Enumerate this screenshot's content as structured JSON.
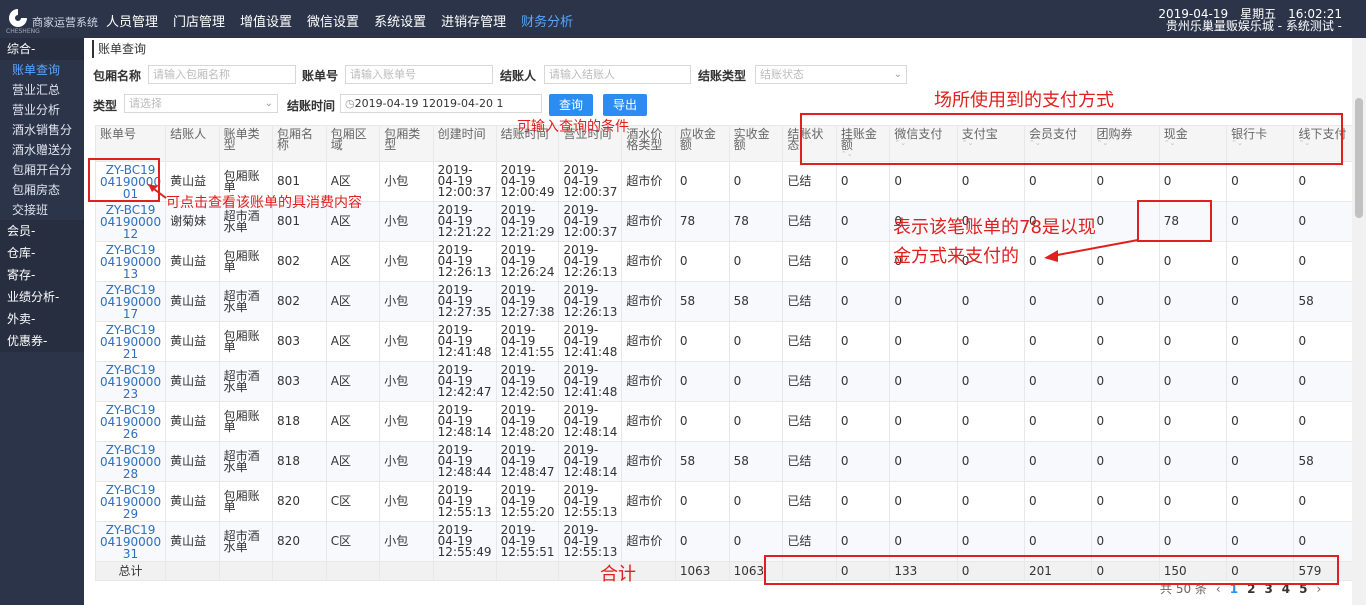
{
  "header": {
    "logo_text": "CHESHENG",
    "brand": "商家运营系统",
    "nav": [
      "人员管理",
      "门店管理",
      "增值设置",
      "微信设置",
      "系统设置",
      "进销存管理",
      "财务分析"
    ],
    "active_nav": "财务分析",
    "datetime": "2019-04-19　星期五　16:02:21",
    "store": "贵州乐巢量贩娱乐城 - 系统测试 -"
  },
  "sidebar": {
    "groups": [
      {
        "label": "综合-",
        "items": [
          "账单查询",
          "营业汇总",
          "营业分析",
          "酒水销售分",
          "酒水赠送分",
          "包厢开台分",
          "包厢房态",
          "交接班"
        ]
      },
      {
        "label": "会员-",
        "items": []
      },
      {
        "label": "仓库-",
        "items": []
      },
      {
        "label": "寄存-",
        "items": []
      },
      {
        "label": "业绩分析-",
        "items": []
      },
      {
        "label": "外卖-",
        "items": []
      },
      {
        "label": "优惠券-",
        "items": []
      }
    ],
    "active_item": "账单查询"
  },
  "breadcrumb": "账单查询",
  "filters": {
    "room_name": {
      "label": "包厢名称",
      "placeholder": "请输入包厢名称"
    },
    "bill_no": {
      "label": "账单号",
      "placeholder": "请输入账单号"
    },
    "cashier": {
      "label": "结账人",
      "placeholder": "请输入结账人"
    },
    "settle_type": {
      "label": "结账类型",
      "placeholder": "结账状态"
    },
    "type": {
      "label": "类型",
      "placeholder": "请选择"
    },
    "settle_time": {
      "label": "结账时间",
      "start": "2019-04-19 1",
      "end": "2019-04-20 1"
    },
    "query_button": "查询",
    "export_button": "导出"
  },
  "table": {
    "columns": [
      "账单号",
      "结账人",
      "账单类型",
      "包厢名称",
      "包厢区域",
      "包厢类型",
      "创建时间",
      "结账时间",
      "营业时间",
      "酒水价格类型",
      "应收金额",
      "实收金额",
      "结账状态",
      "挂账金额",
      "微信支付",
      "支付宝",
      "会员支付",
      "团购券",
      "现金",
      "银行卡",
      "线下支付"
    ],
    "rows": [
      [
        "ZY-BC19 04190000 01",
        "黄山益",
        "包厢账单",
        "801",
        "A区",
        "小包",
        "2019-04-19 12:00:37",
        "2019-04-19 12:00:49",
        "2019-04-19 12:00:37",
        "超市价",
        "0",
        "0",
        "已结",
        "0",
        "0",
        "0",
        "0",
        "0",
        "0",
        "0",
        "0"
      ],
      [
        "ZY-BC19 04190000 12",
        "谢菊妹",
        "超市酒水单",
        "801",
        "A区",
        "小包",
        "2019-04-19 12:21:22",
        "2019-04-19 12:21:29",
        "2019-04-19 12:00:37",
        "超市价",
        "78",
        "78",
        "已结",
        "0",
        "0",
        "0",
        "0",
        "0",
        "78",
        "0",
        "0"
      ],
      [
        "ZY-BC19 04190000 13",
        "黄山益",
        "包厢账单",
        "802",
        "A区",
        "小包",
        "2019-04-19 12:26:13",
        "2019-04-19 12:26:24",
        "2019-04-19 12:26:13",
        "超市价",
        "0",
        "0",
        "已结",
        "0",
        "0",
        "0",
        "0",
        "0",
        "0",
        "0",
        "0"
      ],
      [
        "ZY-BC19 04190000 17",
        "黄山益",
        "超市酒水单",
        "802",
        "A区",
        "小包",
        "2019-04-19 12:27:35",
        "2019-04-19 12:27:38",
        "2019-04-19 12:26:13",
        "超市价",
        "58",
        "58",
        "已结",
        "0",
        "0",
        "0",
        "0",
        "0",
        "0",
        "0",
        "58"
      ],
      [
        "ZY-BC19 04190000 21",
        "黄山益",
        "包厢账单",
        "803",
        "A区",
        "小包",
        "2019-04-19 12:41:48",
        "2019-04-19 12:41:55",
        "2019-04-19 12:41:48",
        "超市价",
        "0",
        "0",
        "已结",
        "0",
        "0",
        "0",
        "0",
        "0",
        "0",
        "0",
        "0"
      ],
      [
        "ZY-BC19 04190000 23",
        "黄山益",
        "超市酒水单",
        "803",
        "A区",
        "小包",
        "2019-04-19 12:42:47",
        "2019-04-19 12:42:50",
        "2019-04-19 12:41:48",
        "超市价",
        "0",
        "0",
        "已结",
        "0",
        "0",
        "0",
        "0",
        "0",
        "0",
        "0",
        "0"
      ],
      [
        "ZY-BC19 04190000 26",
        "黄山益",
        "包厢账单",
        "818",
        "A区",
        "小包",
        "2019-04-19 12:48:14",
        "2019-04-19 12:48:20",
        "2019-04-19 12:48:14",
        "超市价",
        "0",
        "0",
        "已结",
        "0",
        "0",
        "0",
        "0",
        "0",
        "0",
        "0",
        "0"
      ],
      [
        "ZY-BC19 04190000 28",
        "黄山益",
        "超市酒水单",
        "818",
        "A区",
        "小包",
        "2019-04-19 12:48:44",
        "2019-04-19 12:48:47",
        "2019-04-19 12:48:14",
        "超市价",
        "58",
        "58",
        "已结",
        "0",
        "0",
        "0",
        "0",
        "0",
        "0",
        "0",
        "58"
      ],
      [
        "ZY-BC19 04190000 29",
        "黄山益",
        "包厢账单",
        "820",
        "C区",
        "小包",
        "2019-04-19 12:55:13",
        "2019-04-19 12:55:20",
        "2019-04-19 12:55:13",
        "超市价",
        "0",
        "0",
        "已结",
        "0",
        "0",
        "0",
        "0",
        "0",
        "0",
        "0",
        "0"
      ],
      [
        "ZY-BC19 04190000 31",
        "黄山益",
        "超市酒水单",
        "820",
        "C区",
        "小包",
        "2019-04-19 12:55:49",
        "2019-04-19 12:55:51",
        "2019-04-19 12:55:13",
        "超市价",
        "0",
        "0",
        "已结",
        "0",
        "0",
        "0",
        "0",
        "0",
        "0",
        "0",
        "0"
      ]
    ],
    "total_label": "总计",
    "totals": [
      "",
      "",
      "",
      "",
      "",
      "",
      "",
      "",
      "",
      "1063",
      "1063",
      "",
      "0",
      "133",
      "0",
      "201",
      "0",
      "150",
      "0",
      "579"
    ]
  },
  "pagination": {
    "total": "共 50 条",
    "pages": [
      "1",
      "2",
      "3",
      "4",
      "5"
    ],
    "current": "1",
    "prev": "‹",
    "next": "›"
  },
  "annotations": {
    "payment_methods": "场所使用到的支付方式",
    "query_conditions": "可输入查询的条件",
    "click_detail": "可点击查看该账单的具消费内容",
    "cash_note_1": "表示该笔账单的78是以现",
    "cash_note_2": "金方式来支付的",
    "total": "合计"
  },
  "colors": {
    "topbar": "#2b3448",
    "accent": "#2d8cf0",
    "annotation": "#e0201f"
  }
}
